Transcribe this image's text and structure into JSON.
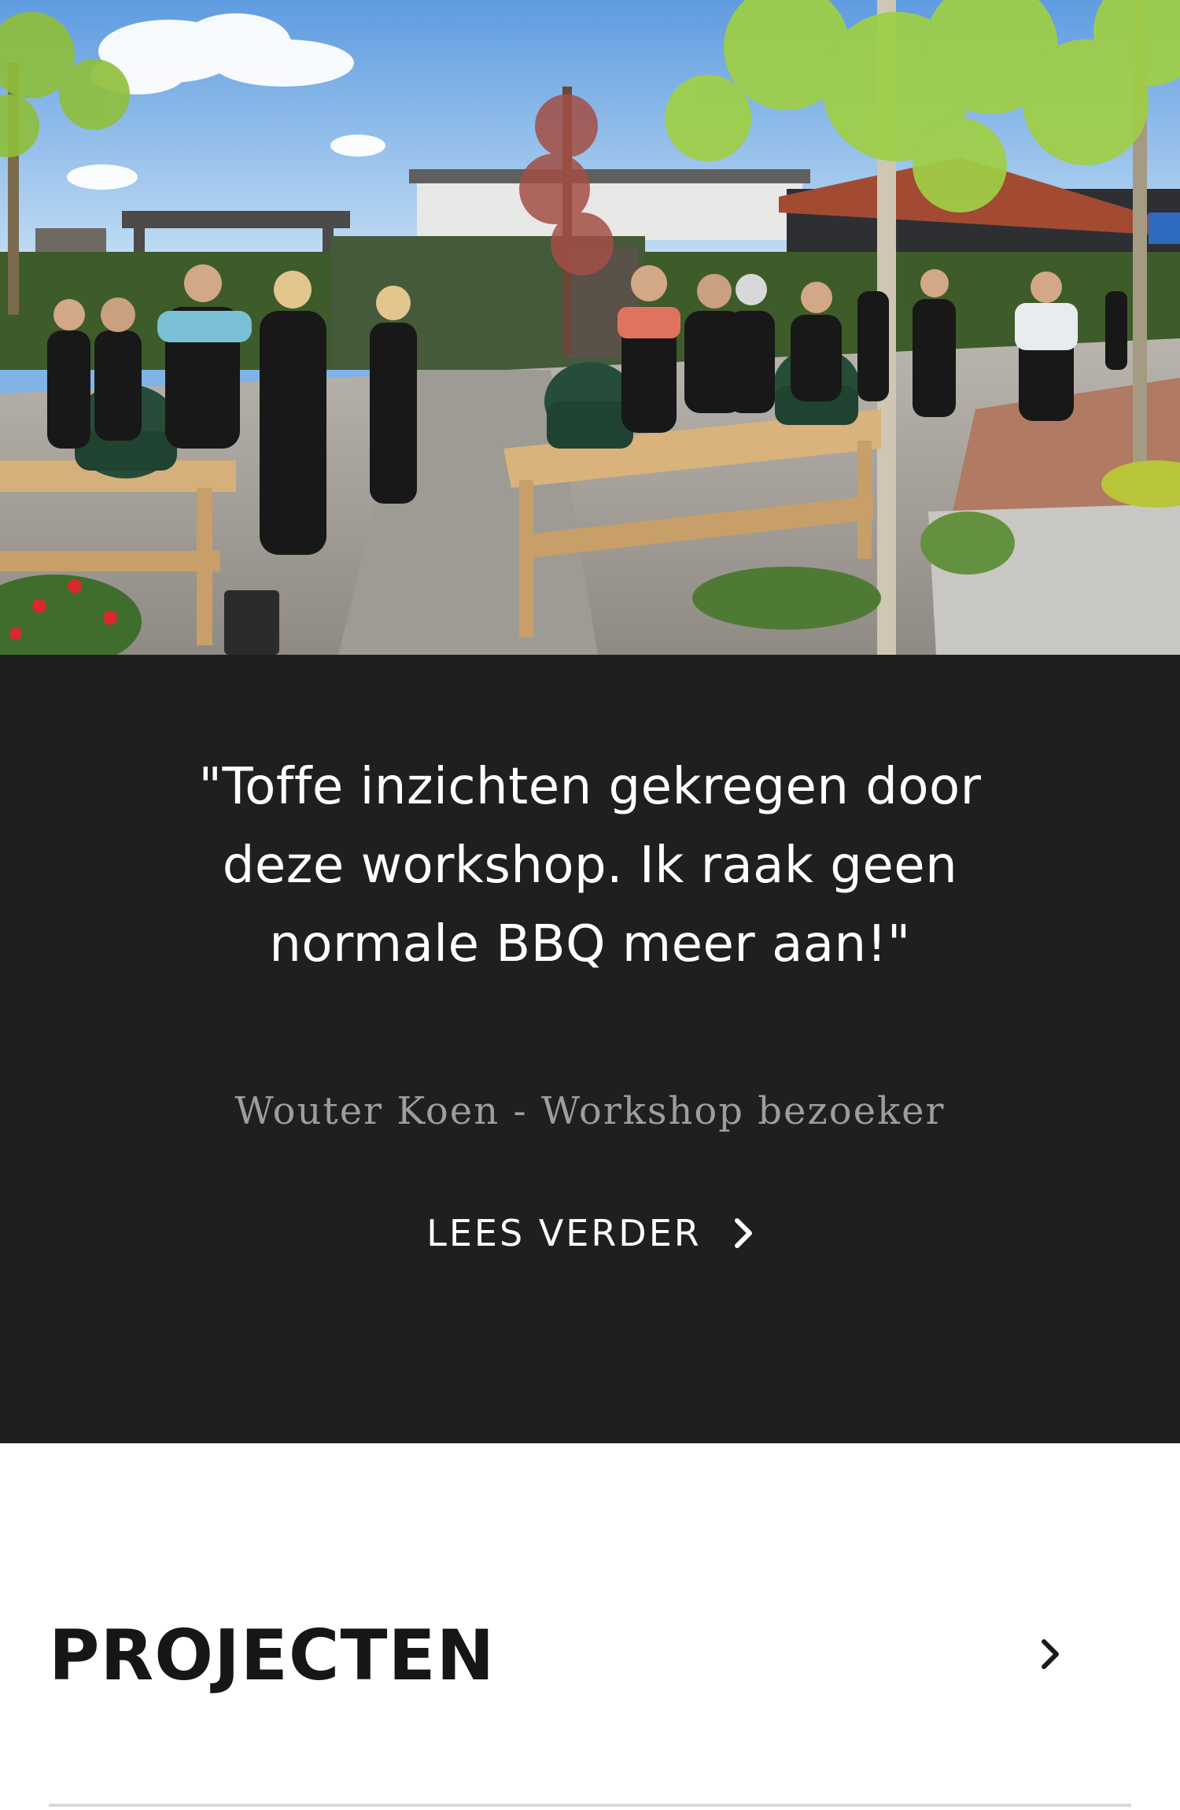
{
  "hero": {
    "image_alt": "",
    "icon": "hero-photo"
  },
  "testimonial": {
    "quote": "\"Toffe inzichten gekregen door deze workshop. Ik raak geen normale BBQ meer aan!\"",
    "author": "Wouter Koen - Workshop bezoeker",
    "read_more_label": "LEES VERDER",
    "read_more_icon": "chevron-right-icon"
  },
  "projects": {
    "title": "PROJECTEN",
    "chevron_icon": "chevron-right-icon"
  },
  "colors": {
    "testimonial_bg": "#1f1f1f",
    "quote_text": "#ffffff",
    "author_text": "#9d9d9d",
    "projects_title": "#161616"
  }
}
